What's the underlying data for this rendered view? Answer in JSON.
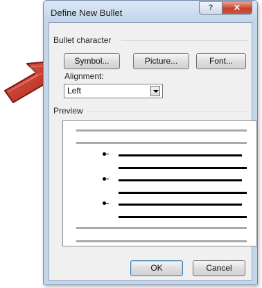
{
  "dialog": {
    "title": "Define New Bullet",
    "help_label": "?",
    "close_label": "✕"
  },
  "bullet_character": {
    "group_label": "Bullet character",
    "buttons": [
      {
        "label": "Symbol..."
      },
      {
        "label": "Picture..."
      },
      {
        "label": "Font..."
      }
    ]
  },
  "alignment": {
    "label": "Alignment:",
    "value": "Left"
  },
  "preview": {
    "label": "Preview"
  },
  "footer": {
    "ok_label": "OK",
    "cancel_label": "Cancel"
  },
  "annotation": {
    "arrow_color": "#c0392b"
  }
}
